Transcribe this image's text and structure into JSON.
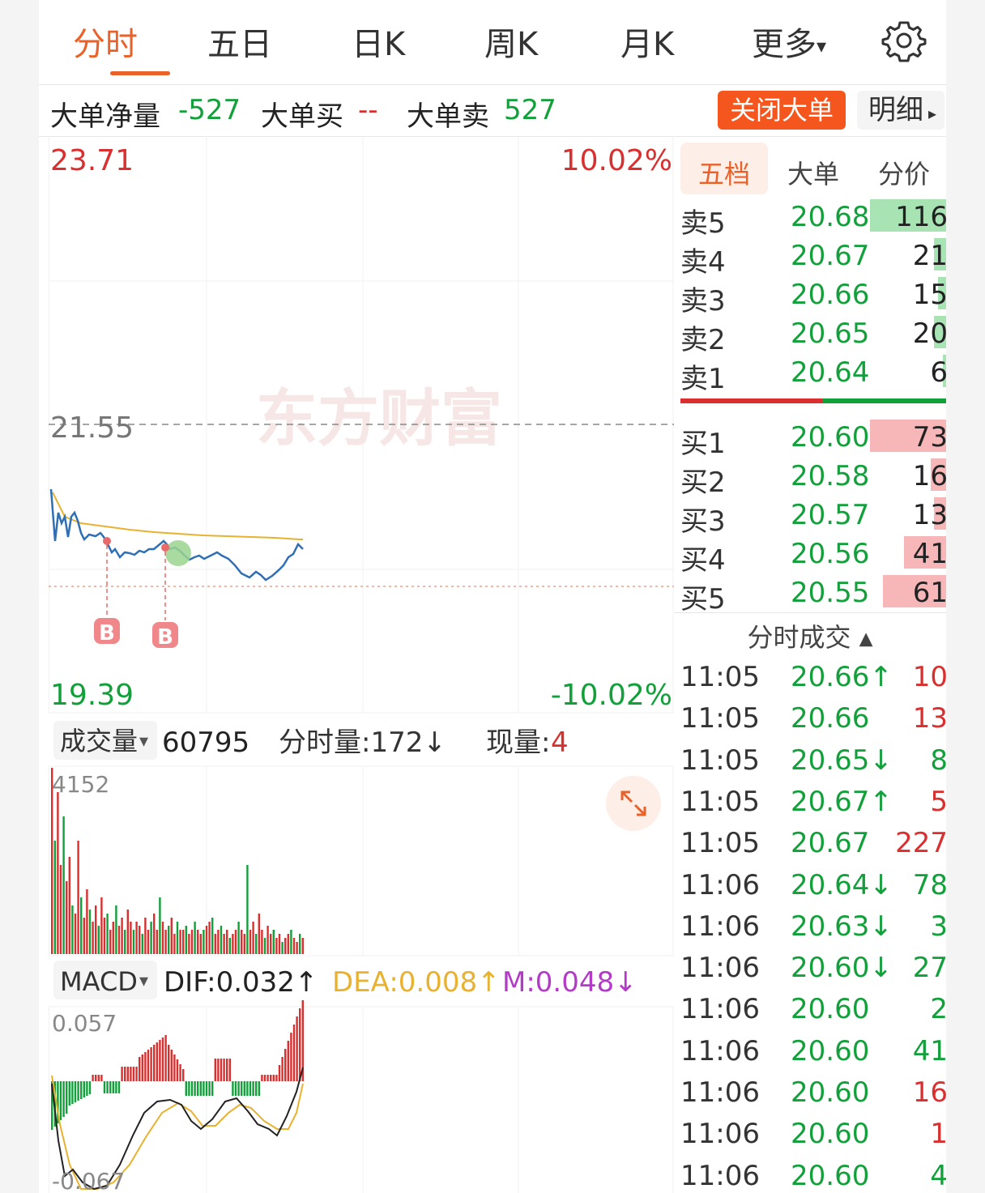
{
  "tabs": [
    "分时",
    "五日",
    "日K",
    "周K",
    "月K",
    "更多"
  ],
  "more_arrow": "▾",
  "big_order": {
    "net_label": "大单净量",
    "net_value": "-527",
    "buy_label": "大单买",
    "buy_value": "--",
    "sell_label": "大单卖",
    "sell_value": "527",
    "close_btn": "关闭大单",
    "detail_btn": "明细",
    "detail_arrow": "▸"
  },
  "price_chart": {
    "top_price": "23.71",
    "top_pct": "10.02%",
    "mid_price": "21.55",
    "bottom_price": "19.39",
    "bottom_pct": "-10.02%",
    "watermark": "东方财富",
    "markers": [
      "B",
      "B"
    ]
  },
  "volume": {
    "label": "成交量",
    "dropdown": "▾",
    "total": "60795",
    "minute_vol": "分时量:172↓",
    "current_label": "现量:",
    "current_value": "4",
    "max": "4152"
  },
  "macd": {
    "label": "MACD",
    "dropdown": "▾",
    "dif": "DIF:0.032↑",
    "dea": "DEA:0.008↑",
    "m": "M:0.048↓",
    "max": "0.057",
    "min": "-0.067"
  },
  "right_tabs": [
    "五档",
    "大单",
    "分价"
  ],
  "asks": [
    {
      "label": "卖5",
      "price": "20.68",
      "vol": "116"
    },
    {
      "label": "卖4",
      "price": "20.67",
      "vol": "21"
    },
    {
      "label": "卖3",
      "price": "20.66",
      "vol": "15"
    },
    {
      "label": "卖2",
      "price": "20.65",
      "vol": "20"
    },
    {
      "label": "卖1",
      "price": "20.64",
      "vol": "6"
    }
  ],
  "bids": [
    {
      "label": "买1",
      "price": "20.60",
      "vol": "73"
    },
    {
      "label": "买2",
      "price": "20.58",
      "vol": "16"
    },
    {
      "label": "买3",
      "price": "20.57",
      "vol": "13"
    },
    {
      "label": "买4",
      "price": "20.56",
      "vol": "41"
    },
    {
      "label": "买5",
      "price": "20.55",
      "vol": "61"
    }
  ],
  "ticks_title": "分时成交",
  "ticks_arrow": "▲",
  "ticks": [
    {
      "time": "11:05",
      "price": "20.66↑",
      "vol": "10",
      "dir": "buy"
    },
    {
      "time": "11:05",
      "price": "20.66",
      "vol": "13",
      "dir": "buy"
    },
    {
      "time": "11:05",
      "price": "20.65↓",
      "vol": "8",
      "dir": "sell"
    },
    {
      "time": "11:05",
      "price": "20.67↑",
      "vol": "5",
      "dir": "buy"
    },
    {
      "time": "11:05",
      "price": "20.67",
      "vol": "227",
      "dir": "buy"
    },
    {
      "time": "11:06",
      "price": "20.64↓",
      "vol": "78",
      "dir": "sell"
    },
    {
      "time": "11:06",
      "price": "20.63↓",
      "vol": "3",
      "dir": "sell"
    },
    {
      "time": "11:06",
      "price": "20.60↓",
      "vol": "27",
      "dir": "sell"
    },
    {
      "time": "11:06",
      "price": "20.60",
      "vol": "2",
      "dir": "sell"
    },
    {
      "time": "11:06",
      "price": "20.60",
      "vol": "41",
      "dir": "sell"
    },
    {
      "time": "11:06",
      "price": "20.60",
      "vol": "16",
      "dir": "buy"
    },
    {
      "time": "11:06",
      "price": "20.60",
      "vol": "1",
      "dir": "buy"
    },
    {
      "time": "11:06",
      "price": "20.60",
      "vol": "4",
      "dir": "sell"
    }
  ],
  "colors": {
    "accent": "#e8622a",
    "up": "#d9302f",
    "down": "#12a03a",
    "avg_line": "#e8b230",
    "price_line": "#2f6fb5",
    "dea": "#e8b230",
    "m": "#b43ac8"
  }
}
